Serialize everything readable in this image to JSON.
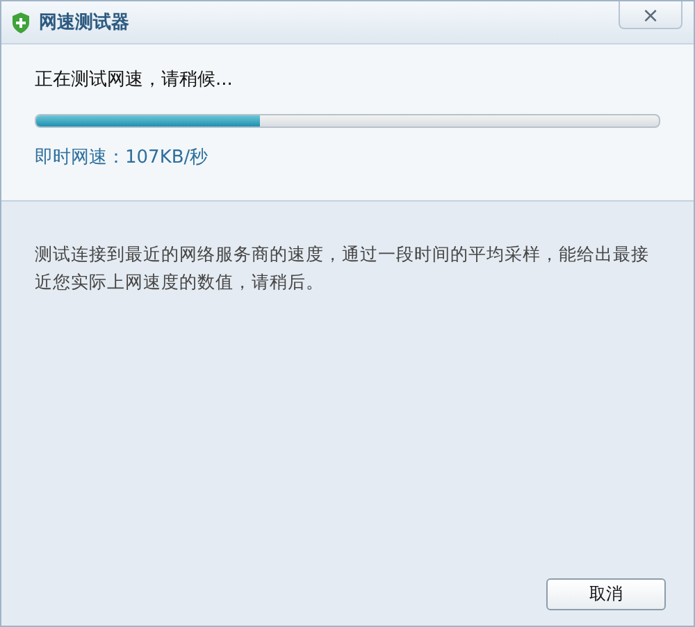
{
  "window": {
    "title": "网速测试器",
    "close": "×"
  },
  "status": "正在测试网速，请稍候...",
  "progress": {
    "level": 0.36
  },
  "speed": "即时网速：107KB/秒",
  "description": "测试连接到最近的网络服务商的速度，通过一段时间的平均采样，能给出最接近您实际上网速度的数值，请稍后。",
  "buttons": [
    "取消"
  ]
}
